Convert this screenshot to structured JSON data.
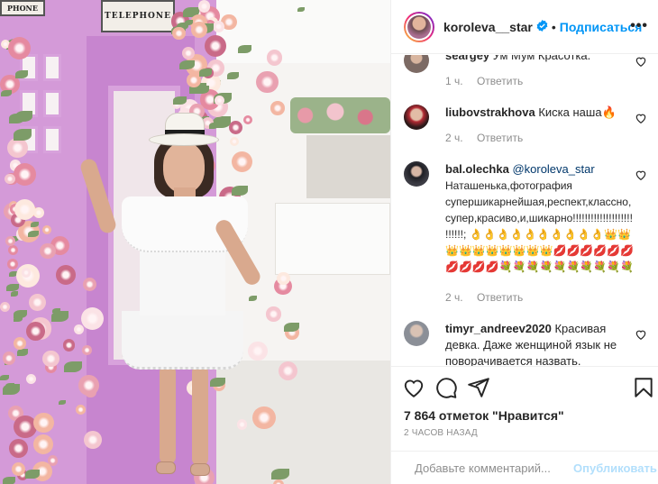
{
  "photo": {
    "sign_main": "TELEPHONE",
    "sign_corner": "PHONE"
  },
  "header": {
    "username": "koroleva__star",
    "verified": true,
    "separator": "•",
    "follow_label": "Подписаться",
    "more_icon": "more-dots-icon"
  },
  "comments": [
    {
      "username": "seargey",
      "text": "Ум Мум Красотка.",
      "time": "1 ч.",
      "reply_label": "Ответить"
    },
    {
      "username": "liubovstrakhova",
      "text": "Киска наша🔥",
      "time": "2 ч.",
      "reply_label": "Ответить"
    },
    {
      "username": "bal.olechka",
      "mention": "@koroleva_star",
      "text": "Наташенька,фотография супершикарнейшая,респект,классно,супер,красиво,и,шикарно!!!!!!!!!!!!!!!!!!!!!!!!!!; 👌👌👌👌👌👌👌👌👌👌👑👑👑👑👑👑👑👑👑👑💋💋💋💋💋💋💋💋💋💋💐💐💐💐💐💐💐💐💐💐",
      "time": "2 ч.",
      "reply_label": "Ответить"
    },
    {
      "username": "timyr_andreev2020",
      "text": "Красивая девка. Даже женщиной язык не поворачивается назвать.",
      "time": "",
      "reply_label": ""
    }
  ],
  "actions": {
    "like_icon": "heart-icon",
    "comment_icon": "comment-icon",
    "share_icon": "share-icon",
    "save_icon": "bookmark-icon",
    "likes_text": "7 864 отметок \"Нравится\"",
    "time_ago": "2 часов назад"
  },
  "add_comment": {
    "placeholder": "Добавьте комментарий...",
    "publish_label": "Опубликовать"
  },
  "colors": {
    "accent": "#0095f6",
    "text": "#262626",
    "muted": "#8e8e8e",
    "publish_disabled": "#b2dffc"
  }
}
